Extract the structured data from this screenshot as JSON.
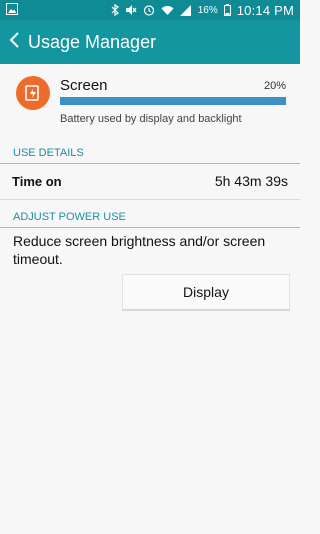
{
  "status_bar": {
    "icons_left": [
      "picture-notification-icon"
    ],
    "icons_right": [
      "bluetooth-icon",
      "mute-icon",
      "alarm-icon",
      "wifi-icon",
      "signal-icon",
      "battery-icon"
    ],
    "battery_percent": "16%",
    "time": "10:14 PM"
  },
  "header": {
    "title": "Usage Manager",
    "color": "#1396a0",
    "back_icon": "chevron-left-icon"
  },
  "summary": {
    "item": "Screen",
    "percent": "20%",
    "fill_fraction": 1.0,
    "description": "Battery used by display and backlight",
    "icon": "screen-power-icon",
    "icon_color": "#ee6c2b"
  },
  "use_details": {
    "header": "USE DETAILS",
    "time_on_label": "Time on",
    "time_on_value": "5h 43m 39s"
  },
  "adjust_power": {
    "header": "ADJUST POWER USE",
    "advice": "Reduce screen brightness and/or screen timeout.",
    "button_label": "Display"
  }
}
